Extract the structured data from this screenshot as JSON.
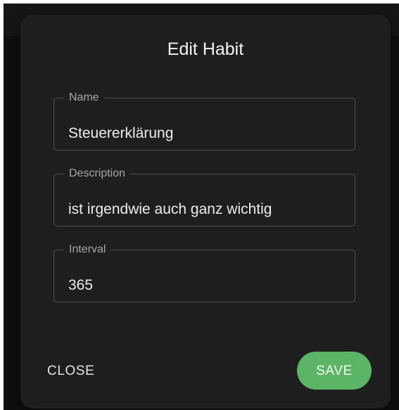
{
  "dialog": {
    "title": "Edit Habit",
    "fields": {
      "name": {
        "label": "Name",
        "value": "Steuererklärung"
      },
      "description": {
        "label": "Description",
        "value": "ist irgendwie auch ganz wichtig"
      },
      "interval": {
        "label": "Interval",
        "value": "365"
      }
    },
    "actions": {
      "close_label": "CLOSE",
      "save_label": "SAVE"
    }
  },
  "colors": {
    "dialog_background": "#1e1e1e",
    "field_border": "#4f4f4f",
    "save_button": "#5cb567",
    "text": "#ececec",
    "label_text": "#a7a7a7"
  }
}
